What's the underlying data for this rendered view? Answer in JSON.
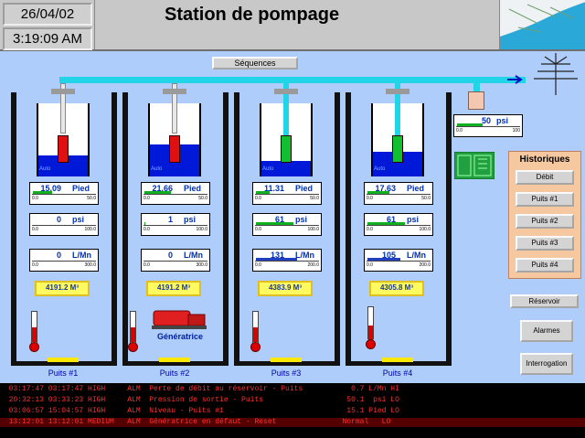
{
  "header": {
    "date": "26/04/02",
    "time": "3:19:09 AM",
    "title": "Station de pompage"
  },
  "sequences_label": "Séquences",
  "output_meter": {
    "value": "50",
    "unit": "psi",
    "min": "0.0",
    "max": "100"
  },
  "historiques": {
    "title": "Historiques",
    "items": [
      "Débit",
      "Puits #1",
      "Puits #2",
      "Puits #3",
      "Puits #4"
    ]
  },
  "buttons": {
    "reservoir": "Réservoir",
    "alarmes": "Alarmes",
    "interrogation": "Interrogation"
  },
  "generatrice_label": "Génératrice",
  "auto_label": "Auto",
  "wells": [
    {
      "name": "Puits #1",
      "level": "15.09",
      "level_unit": "Pied",
      "level_min": "0.0",
      "level_max": "50.0",
      "pressure": "0",
      "pressure_unit": "psi",
      "pressure_min": "0.0",
      "pressure_max": "100.0",
      "flow": "0",
      "flow_unit": "L/Mn",
      "flow_min": "0.0",
      "flow_max": "300.0",
      "total": "4191.2 M³",
      "water_fraction": 0.3,
      "pump_on": false
    },
    {
      "name": "Puits #2",
      "level": "21.66",
      "level_unit": "Pied",
      "level_min": "0.0",
      "level_max": "50.0",
      "pressure": "1",
      "pressure_unit": "psi",
      "pressure_min": "0.0",
      "pressure_max": "100.0",
      "flow": "0",
      "flow_unit": "L/Mn",
      "flow_min": "0.0",
      "flow_max": "300.0",
      "total": "4191.2 M³",
      "water_fraction": 0.45,
      "pump_on": false
    },
    {
      "name": "Puits #3",
      "level": "11.31",
      "level_unit": "Pied",
      "level_min": "0.0",
      "level_max": "50.0",
      "pressure": "61",
      "pressure_unit": "psi",
      "pressure_min": "0.0",
      "pressure_max": "100.0",
      "flow": "131",
      "flow_unit": "L/Mn",
      "flow_min": "0.0",
      "flow_max": "200.0",
      "total": "4383.9 M³",
      "water_fraction": 0.22,
      "pump_on": true
    },
    {
      "name": "Puits #4",
      "level": "17.63",
      "level_unit": "Pied",
      "level_min": "0.0",
      "level_max": "50.0",
      "pressure": "61",
      "pressure_unit": "psi",
      "pressure_min": "0.0",
      "pressure_max": "100.0",
      "flow": "105",
      "flow_unit": "L/Mn",
      "flow_min": "0.0",
      "flow_max": "200.0",
      "total": "4305.8 M³",
      "water_fraction": 0.35,
      "pump_on": true
    }
  ],
  "alarms": [
    {
      "text": "  03:17:47 03:17:47 HIGH     ALM  Perte de débit au réservoir - Puits           0.7 L/Mn HI",
      "color": "#ff3030"
    },
    {
      "text": "  20:32:13 03:33:23 HIGH     ALM  Pression de sortie - Puits                   50.1  psi LO",
      "color": "#ff3030"
    },
    {
      "text": "  03:06:57 15:04:57 HIGH     ALM  Niveau - Puits #1                            15.1 Pied LO",
      "color": "#ff3030"
    },
    {
      "text": "  13:12:01 13:12:01 MEDIUM   ALM  Génératrice en défaut - Reset               Normal   LO",
      "color": "#ff3030"
    }
  ],
  "colors": {
    "pump_off": "#e01010",
    "pump_on": "#10c030",
    "water": "#0018d8",
    "pipe": "#22d4e8"
  }
}
